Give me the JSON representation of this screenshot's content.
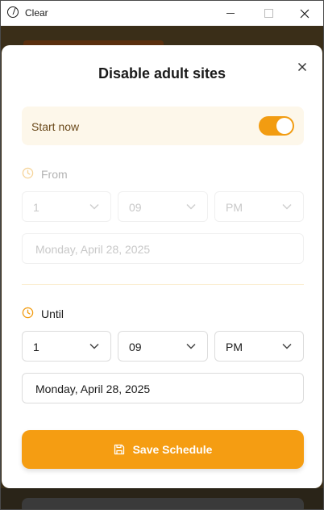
{
  "window": {
    "title": "Clear"
  },
  "modal": {
    "title": "Disable adult sites"
  },
  "start_now": {
    "label": "Start now",
    "enabled": true,
    "accent": "#f29c11"
  },
  "from": {
    "label": "From",
    "hour": "1",
    "minute": "09",
    "ampm": "PM",
    "date": "Monday, April 28, 2025",
    "disabled": true
  },
  "until": {
    "label": "Until",
    "hour": "1",
    "minute": "09",
    "ampm": "PM",
    "date": "Monday, April 28, 2025",
    "disabled": false
  },
  "save": {
    "label": "Save Schedule",
    "color": "#f59d12"
  },
  "icons": {
    "app": "clear-logo-icon",
    "close": "close-icon",
    "clock": "clock-icon",
    "chevron": "chevron-down-icon",
    "save": "save-icon"
  }
}
